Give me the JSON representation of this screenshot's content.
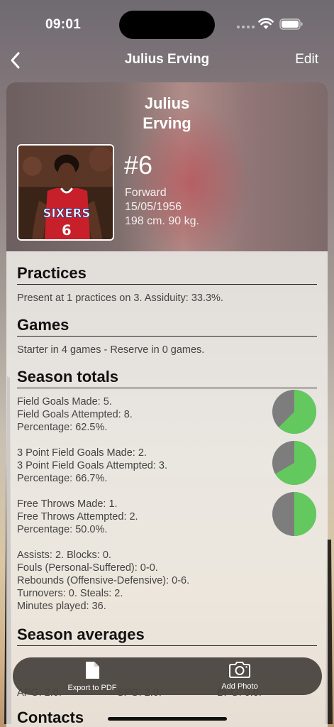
{
  "status": {
    "time": "09:01"
  },
  "nav": {
    "title": "Julius Erving",
    "edit_label": "Edit",
    "back_icon": "chevron-left-icon"
  },
  "player": {
    "name_line1": "Julius",
    "name_line2": "Erving",
    "number": "#6",
    "position": "Forward",
    "birthdate": "15/05/1956",
    "size": "198 cm. 90 kg."
  },
  "practices": {
    "title": "Practices",
    "text": "Present at 1 practices on 3. Assiduity: 33.3%."
  },
  "games": {
    "title": "Games",
    "text": "Starter in 4 games - Reserve in 0 games."
  },
  "season_totals": {
    "title": "Season totals",
    "field_goals": {
      "line1": "Field Goals Made: 5.",
      "line2": "Field Goals Attempted: 8.",
      "line3": "Percentage: 62.5%.",
      "fraction": 0.625
    },
    "three_point": {
      "line1": "3 Point Field Goals Made: 2.",
      "line2": "3 Point Field Goals Attempted: 3.",
      "line3": "Percentage: 66.7%.",
      "fraction": 0.667
    },
    "free_throws": {
      "line1": "Free Throws Made: 1.",
      "line2": "Free Throws Attempted: 2.",
      "line3": "Percentage: 50.0%.",
      "fraction": 0.5
    },
    "misc": [
      "Assists: 2. Blocks: 0.",
      "Fouls (Personal-Suffered): 0-0.",
      "Rebounds (Offensive-Defensive): 0-6.",
      "Turnovers: 0. Steals: 2.",
      "Minutes played: 36."
    ]
  },
  "season_averages": {
    "title": "Season averages",
    "apg": "APG: 2.0.",
    "spg": "SPG: 2.0.",
    "bpg": "BPG: 0.0."
  },
  "next_section": {
    "title": "Contacts"
  },
  "toolbar": {
    "export_label": "Export to PDF",
    "photo_label": "Add Photo"
  },
  "colors": {
    "pie_made": "#63c95f",
    "pie_missed": "#7d7d7d"
  }
}
